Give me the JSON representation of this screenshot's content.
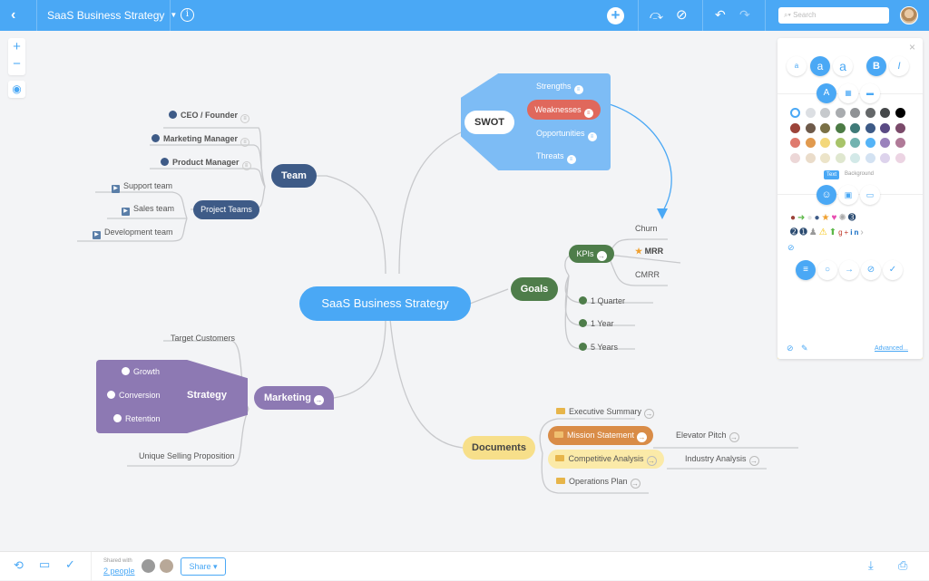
{
  "topbar": {
    "back_icon": "chevron-left-icon",
    "title": "SaaS Business Strategy",
    "info_icon": "info-icon",
    "add_icon": "plus-icon",
    "connection_icon": "connection-icon",
    "no_icon": "prohibit-icon",
    "undo_icon": "undo-icon",
    "redo_icon": "redo-icon",
    "search_placeholder": "Search"
  },
  "canvas_controls": {
    "zoom_in": "+",
    "zoom_out": "−",
    "center": "◉"
  },
  "mindmap": {
    "root": "SaaS Business Strategy",
    "team": {
      "label": "Team",
      "children": [
        "CEO / Founder",
        "Marketing Manager",
        "Product Manager"
      ],
      "project_teams": {
        "label": "Project Teams",
        "children": [
          "Support team",
          "Sales team",
          "Development team"
        ]
      }
    },
    "swot": {
      "label": "SWOT",
      "children": [
        "Strengths",
        "Weaknesses",
        "Opportunities",
        "Threats"
      ]
    },
    "goals": {
      "label": "Goals",
      "kpis": {
        "label": "KPIs",
        "children": [
          "Churn",
          "MRR",
          "CMRR"
        ]
      },
      "children": [
        "1 Quarter",
        "1 Year",
        "5 Years"
      ]
    },
    "marketing": {
      "label": "Marketing",
      "children": [
        "Target Customers",
        "Unique Selling Proposition"
      ],
      "strategy": {
        "label": "Strategy",
        "children": [
          "Growth",
          "Conversion",
          "Retention"
        ]
      }
    },
    "documents": {
      "label": "Documents",
      "children": [
        "Executive Summary",
        "Mission Statement",
        "Competitive Analysis",
        "Operations Plan"
      ],
      "mission_child": "Elevator Pitch",
      "competitive_child": "Industry Analysis"
    }
  },
  "panel": {
    "close": "×",
    "font_sizes": [
      "a",
      "a",
      "a"
    ],
    "bold": "B",
    "italic": "I",
    "tab_text": "Text",
    "tab_background": "Background",
    "advanced": "Advanced...",
    "colors": [
      [
        "#ffffff",
        "#dcdfe3",
        "#c6c9cc",
        "#a9acaf",
        "#8f9295",
        "#646769",
        "#45484a",
        "#000000"
      ],
      [
        "#9c4339",
        "#6e5a4a",
        "#7a7045",
        "#4c7b45",
        "#3f7a78",
        "#3d5a86",
        "#5a4a84",
        "#7a4a6a"
      ],
      [
        "#df7a6e",
        "#e19a4f",
        "#f3d77a",
        "#a8c46a",
        "#72b3b0",
        "#55b4f7",
        "#9a82bc",
        "#b07a98"
      ],
      [
        "#ecd7d7",
        "#eadcca",
        "#ece4c9",
        "#dfe7cf",
        "#d3e9e8",
        "#d3e2f2",
        "#ddd3ec",
        "#ecd4e3"
      ]
    ]
  },
  "bottombar": {
    "shared_with": "Shared with",
    "people": "2 people",
    "share": "Share"
  },
  "colors": {
    "accent": "#4aa8f5",
    "team": "#3e5b87",
    "goals": "#4e7d4a",
    "marketing": "#8d79b3",
    "documents": "#f7df8a",
    "weakness": "#e0685c",
    "mission": "#d98c47"
  }
}
